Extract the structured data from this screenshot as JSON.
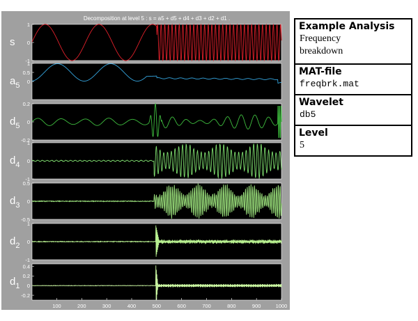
{
  "figure": {
    "title": "Decomposition at level 5 : s = a5 + d5 + d4 + d3 + d2 + d1 .",
    "background": "#a0a0a0",
    "axes_background": "#000000",
    "x_ticks": [
      "100",
      "200",
      "300",
      "400",
      "500",
      "600",
      "700",
      "800",
      "900",
      "1000"
    ]
  },
  "chart_data": {
    "type": "line",
    "x_range": [
      1,
      1000
    ],
    "subplots": [
      {
        "label_main": "s",
        "label_sub": "",
        "color": "#e0202a",
        "ylim": [
          -1,
          1
        ],
        "y_ticks": [
          "1",
          "0",
          "-1"
        ]
      },
      {
        "label_main": "a",
        "label_sub": "5",
        "color": "#35a6e0",
        "ylim": [
          -1,
          1
        ],
        "y_ticks": [
          "1",
          "0.5",
          "0"
        ]
      },
      {
        "label_main": "d",
        "label_sub": "5",
        "color": "#3fbf3f",
        "ylim": [
          -0.2,
          0.2
        ],
        "y_ticks": [
          "0.2",
          "0",
          "-0.2"
        ]
      },
      {
        "label_main": "d",
        "label_sub": "4",
        "color": "#7fdf6f",
        "ylim": [
          -1,
          1
        ],
        "y_ticks": [
          "1",
          "0",
          "-1"
        ]
      },
      {
        "label_main": "d",
        "label_sub": "3",
        "color": "#a0e880",
        "ylim": [
          -0.5,
          0.5
        ],
        "y_ticks": [
          "0.5",
          "0",
          "-0.5"
        ]
      },
      {
        "label_main": "d",
        "label_sub": "2",
        "color": "#b8f090",
        "ylim": [
          -1,
          1
        ],
        "y_ticks": [
          "1",
          "0",
          "-1"
        ]
      },
      {
        "label_main": "d",
        "label_sub": "1",
        "color": "#c8f4a0",
        "ylim": [
          -0.3,
          0.45
        ],
        "y_ticks": [
          "0.4",
          "0.2",
          "0",
          "-0.2"
        ]
      }
    ]
  },
  "panels": {
    "analysis": {
      "heading": "Example Analysis",
      "value_line1": "Frequency",
      "value_line2": "breakdown"
    },
    "matfile": {
      "heading": "MAT-file",
      "value": "freqbrk.mat"
    },
    "wavelet": {
      "heading": "Wavelet",
      "value": "db5"
    },
    "level": {
      "heading": "Level",
      "value": "5"
    }
  }
}
